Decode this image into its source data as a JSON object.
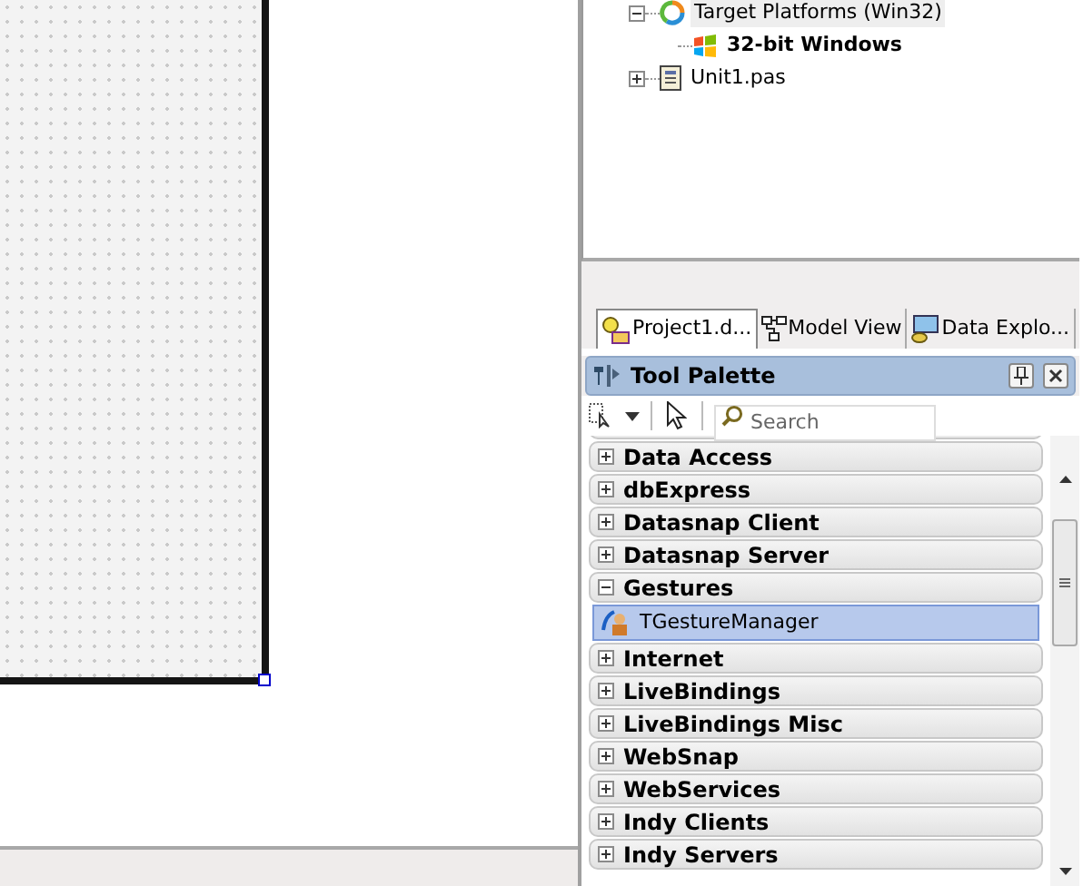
{
  "project_tree": [
    {
      "label": "Target Platforms (Win32)",
      "kind": "platforms",
      "expanded": true,
      "selected": true,
      "children": [
        {
          "label": "32-bit Windows",
          "kind": "windows",
          "bold": true,
          "selected": false
        }
      ]
    },
    {
      "label": "Unit1.pas",
      "kind": "unit",
      "expanded": false,
      "selected": false
    }
  ],
  "tabs": [
    {
      "label": "Project1.d...",
      "kind": "project",
      "selected": true
    },
    {
      "label": "Model View",
      "kind": "model",
      "selected": false
    },
    {
      "label": "Data Explo...",
      "kind": "data",
      "selected": false
    }
  ],
  "tool_palette": {
    "title": "Tool Palette",
    "search": {
      "placeholder": "Search"
    },
    "categories": [
      {
        "name": "Data Access",
        "expanded": false
      },
      {
        "name": "dbExpress",
        "expanded": false
      },
      {
        "name": "Datasnap Client",
        "expanded": false
      },
      {
        "name": "Datasnap Server",
        "expanded": false
      },
      {
        "name": "Gestures",
        "expanded": true,
        "items": [
          {
            "name": "TGestureManager",
            "selected": true
          }
        ]
      },
      {
        "name": "Internet",
        "expanded": false
      },
      {
        "name": "LiveBindings",
        "expanded": false
      },
      {
        "name": "LiveBindings Misc",
        "expanded": false
      },
      {
        "name": "WebSnap",
        "expanded": false
      },
      {
        "name": "WebServices",
        "expanded": false
      },
      {
        "name": "Indy Clients",
        "expanded": false
      },
      {
        "name": "Indy Servers",
        "expanded": false
      }
    ]
  }
}
